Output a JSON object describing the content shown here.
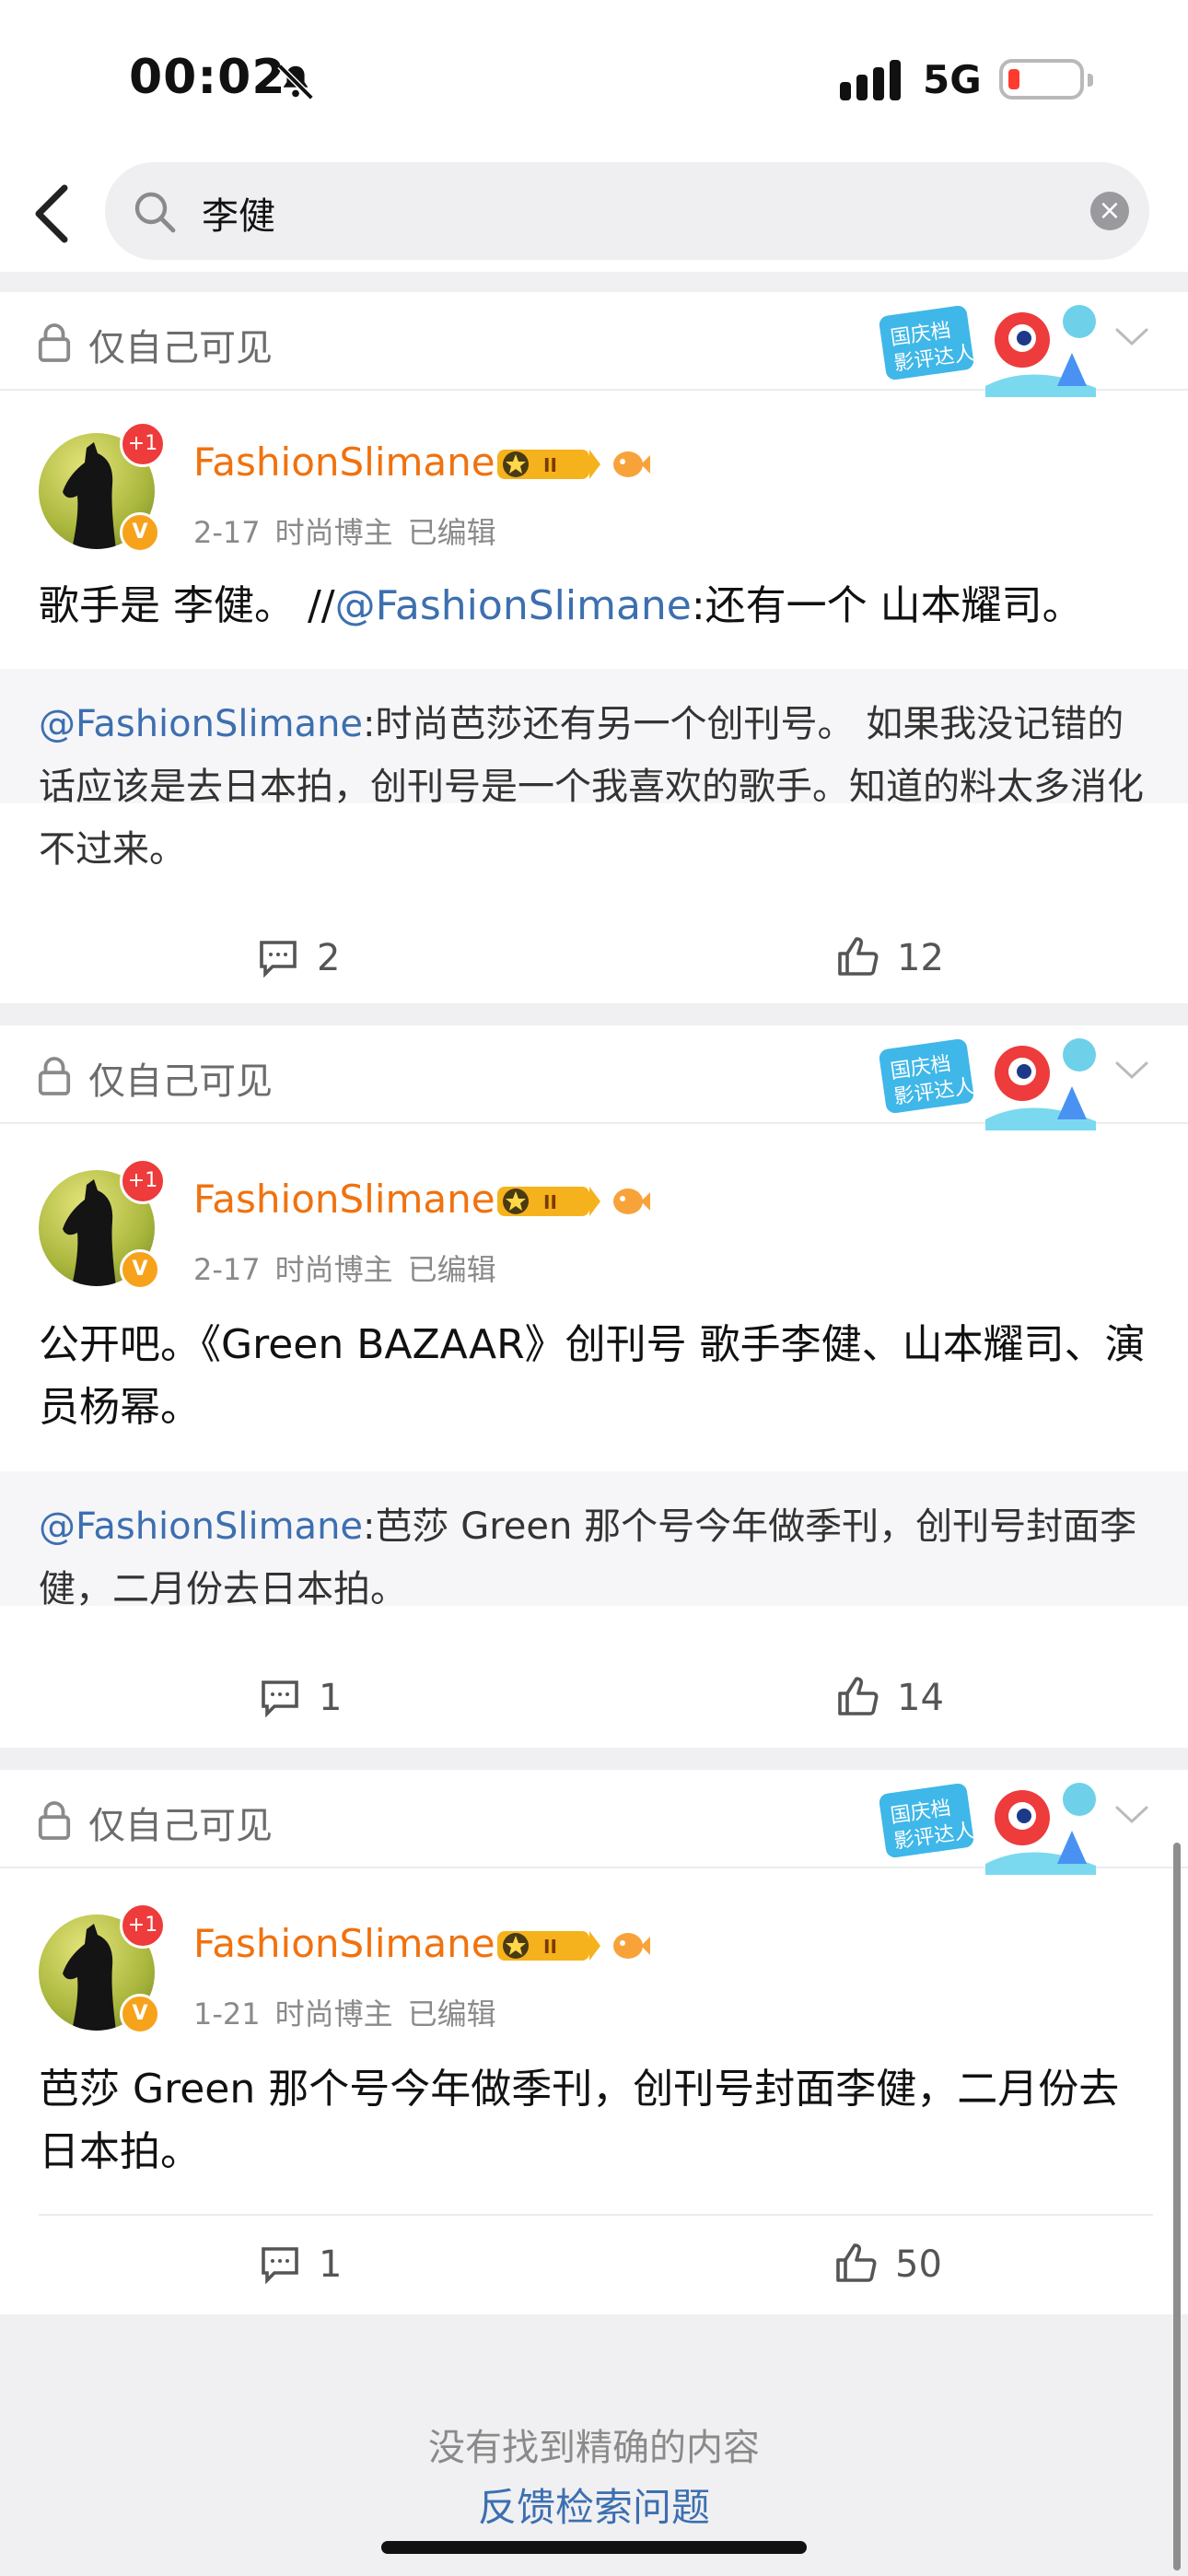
{
  "status": {
    "time": "00:02",
    "network": "5G"
  },
  "search": {
    "query": "李健"
  },
  "posts": [
    {
      "visibility": "仅自己可见",
      "author": "FashionSlimane",
      "avatar_badge": "+1",
      "date": "2-17",
      "role": "时尚博主",
      "edited": "已编辑",
      "text_plain": "歌手是 李健。 //",
      "text_mention": "@FashionSlimane",
      "text_after": ":还有一个 山本耀司。",
      "quote_mention": "@FashionSlimane",
      "quote_text": ":时尚芭莎还有另一个创刊号。 如果我没记错的话应该是去日本拍，创刊号是一个我喜欢的歌手。知道的料太多消化不过来。",
      "comments": "2",
      "likes": "12"
    },
    {
      "visibility": "仅自己可见",
      "author": "FashionSlimane",
      "avatar_badge": "+1",
      "date": "2-17",
      "role": "时尚博主",
      "edited": "已编辑",
      "text": "公开吧。《Green BAZAAR》创刊号 歌手李健、山本耀司、演员杨幂。",
      "quote_mention": "@FashionSlimane",
      "quote_text": ":芭莎 Green 那个号今年做季刊，创刊号封面李健，二月份去日本拍。",
      "comments": "1",
      "likes": "14"
    },
    {
      "visibility": "仅自己可见",
      "author": "FashionSlimane",
      "avatar_badge": "+1",
      "date": "1-21",
      "role": "时尚博主",
      "edited": "已编辑",
      "text": "芭莎 Green 那个号今年做季刊，创刊号封面李健，二月份去日本拍。",
      "comments": "1",
      "likes": "50"
    }
  ],
  "badge_text": "国庆档影评达人",
  "footer": {
    "no_result": "没有找到精确的内容",
    "feedback": "反馈检索问题"
  },
  "colors": {
    "author": "#f0720f",
    "link": "#3d6fb0",
    "muted": "#8a8a8a"
  }
}
